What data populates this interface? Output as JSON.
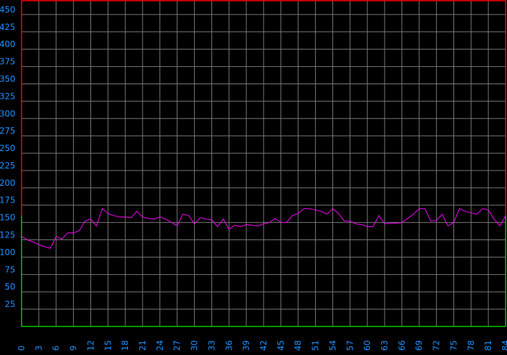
{
  "chart_data": {
    "type": "line",
    "title": "",
    "xlabel": "",
    "ylabel": "",
    "xlim": [
      0,
      84
    ],
    "ylim": [
      0,
      470
    ],
    "x_ticks": [
      "0",
      "3",
      "6",
      "9",
      "12",
      "15",
      "18",
      "21",
      "24",
      "27",
      "30",
      "33",
      "36",
      "39",
      "42",
      "45",
      "48",
      "51",
      "54",
      "57",
      "60",
      "63",
      "66",
      "69",
      "72",
      "75",
      "78",
      "81",
      "84"
    ],
    "y_ticks": [
      "25",
      "50",
      "75",
      "100",
      "125",
      "150",
      "175",
      "200",
      "225",
      "250",
      "275",
      "300",
      "325",
      "350",
      "375",
      "400",
      "425",
      "450"
    ],
    "grid": true,
    "zone_threshold": 160,
    "colors": {
      "background": "#000000",
      "grid": "#7a7a7a",
      "series": "#ff00ff",
      "border_high": "#ff0000",
      "border_low": "#00cc00",
      "tick_label": "#1e90ff"
    },
    "series": [
      {
        "x": [
          0,
          1,
          2,
          3,
          4,
          5,
          6,
          7,
          8,
          9,
          10,
          11,
          12,
          13,
          14,
          15,
          16,
          17,
          18,
          19,
          20,
          21,
          22,
          23,
          24,
          25,
          26,
          27,
          28,
          29,
          30,
          31,
          32,
          33,
          34,
          35,
          36,
          37,
          38,
          39,
          40,
          41,
          42,
          43,
          44,
          45,
          46,
          47,
          48,
          49,
          50,
          51,
          52,
          53,
          54,
          55,
          56,
          57,
          58,
          59,
          60,
          61,
          62,
          63,
          64,
          65,
          66,
          67,
          68,
          69,
          70,
          71,
          72,
          73,
          74,
          75,
          76,
          77,
          78,
          79,
          80,
          81,
          82,
          83,
          84
        ],
        "values": [
          130,
          125,
          122,
          118,
          115,
          113,
          130,
          126,
          135,
          135,
          138,
          152,
          155,
          145,
          170,
          163,
          160,
          158,
          158,
          157,
          166,
          158,
          156,
          155,
          158,
          155,
          150,
          145,
          162,
          160,
          148,
          157,
          155,
          154,
          144,
          155,
          140,
          146,
          144,
          147,
          146,
          145,
          148,
          150,
          156,
          150,
          150,
          160,
          163,
          170,
          170,
          168,
          166,
          162,
          170,
          163,
          152,
          152,
          148,
          147,
          144,
          144,
          160,
          148,
          149,
          149,
          150,
          156,
          162,
          170,
          170,
          152,
          153,
          162,
          145,
          150,
          170,
          166,
          164,
          162,
          170,
          168,
          155,
          145,
          160
        ]
      }
    ]
  }
}
